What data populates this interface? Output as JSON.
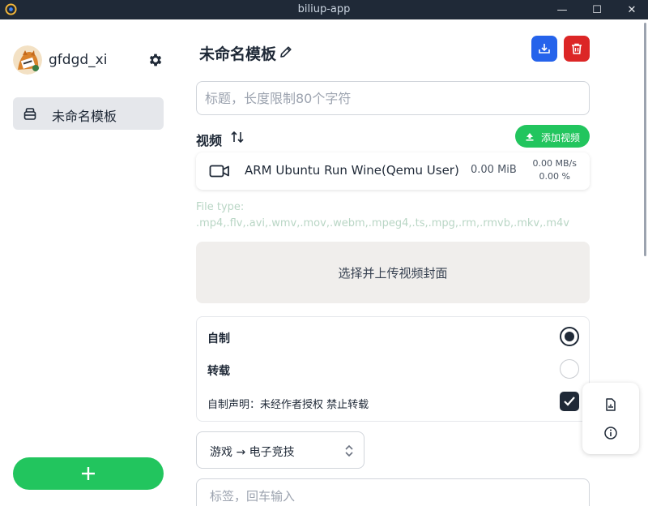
{
  "window": {
    "title": "biliup-app",
    "minimize_glyph": "—",
    "maximize_glyph": "☐",
    "close_glyph": "✕"
  },
  "sidebar": {
    "username": "gfdgd_xi",
    "templates": [
      {
        "label": "未命名模板",
        "icon": "archive-icon",
        "selected": true
      }
    ]
  },
  "main": {
    "template_title": "未命名模板",
    "title_input": {
      "placeholder": "标题，长度限制80个字符",
      "value": ""
    },
    "video_section": {
      "label": "视频",
      "add_button_label": "添加视频",
      "videos": [
        {
          "name": "ARM Ubuntu Run Wine(Qemu User)",
          "size": "0.00 MiB",
          "speed": "0.00 MB/s",
          "percent": "0.00 %"
        }
      ]
    },
    "file_type": {
      "label": "File type:",
      "extensions": ".mp4,.flv,.avi,.wmv,.mov,.webm,.mpeg4,.ts,.mpg,.rm,.rmvb,.mkv,.m4v"
    },
    "cover_upload_label": "选择并上传视频封面",
    "copyright": {
      "original_label": "自制",
      "repost_label": "转载",
      "selected": "original",
      "declaration_label": "自制声明：未经作者授权 禁止转载",
      "declaration_checked": true
    },
    "category": {
      "value": "游戏 → 电子竞技"
    },
    "tag_input": {
      "placeholder": "标签，回车输入",
      "value": ""
    }
  },
  "colors": {
    "accent_green": "#22c55e",
    "save_blue": "#2563eb",
    "delete_red": "#dc2626",
    "dark": "#1f2937",
    "titlebar": "#1f2937"
  }
}
